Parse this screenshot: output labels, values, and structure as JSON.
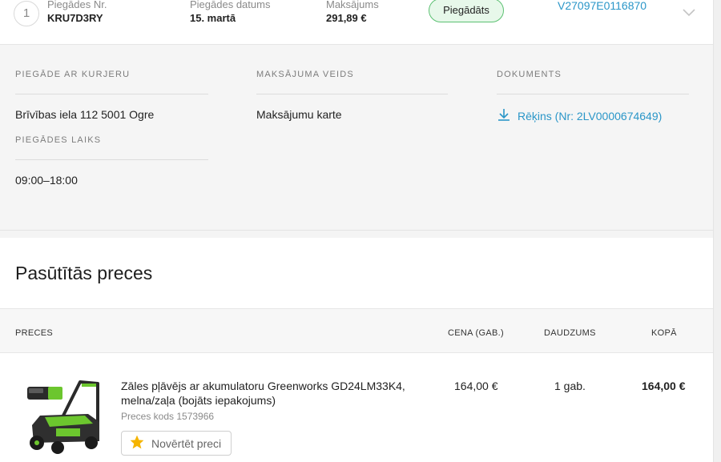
{
  "order": {
    "step": "1",
    "delivery_number_label": "Piegādes Nr.",
    "delivery_number": "KRU7D3RY",
    "delivery_date_label": "Piegādes datums",
    "delivery_date": "15. martā",
    "payment_label": "Maksājums",
    "payment_amount": "291,89 €",
    "status": "Piegādāts",
    "tracking_code": "V27097E0116870"
  },
  "details": {
    "courier_heading": "PIEGĀDE AR KURJERU",
    "address": "Brīvības iela 112 5001 Ogre",
    "time_heading": "PIEGĀDES LAIKS",
    "time_value": "09:00–18:00",
    "payment_method_heading": "MAKSĀJUMA VEIDS",
    "payment_method": "Maksājumu karte",
    "documents_heading": "DOKUMENTS",
    "invoice_link": "Rēķins (Nr: 2LV0000674649)"
  },
  "products": {
    "title": "Pasūtītās preces",
    "columns": {
      "item": "PRECES",
      "price": "CENA (GAB.)",
      "quantity": "DAUDZUMS",
      "total": "KOPĀ"
    },
    "items": [
      {
        "name": "Zāles pļāvējs ar akumulatoru Greenworks GD24LM33K4, melna/zaļa (bojāts iepakojums)",
        "code": "Preces kods 1573966",
        "price": "164,00 €",
        "quantity": "1 gab.",
        "total": "164,00 €",
        "rate_label": "Novērtēt preci"
      }
    ]
  },
  "colors": {
    "accent_link": "#2a96c8",
    "status_green": "#5cc172",
    "star": "#f5b400"
  },
  "icons": [
    "chevron-down-icon",
    "download-icon",
    "star-icon"
  ]
}
